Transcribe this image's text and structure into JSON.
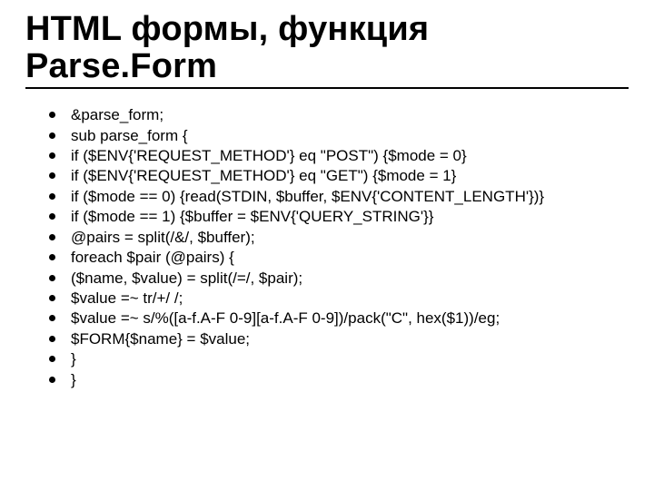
{
  "title_line1": "HTML формы, функция",
  "title_line2": "Parse.Form",
  "lines": [
    "&parse_form;",
    "sub parse_form {",
    "if ($ENV{'REQUEST_METHOD'} eq \"POST\") {$mode = 0}",
    "if ($ENV{'REQUEST_METHOD'} eq \"GET\") {$mode = 1}",
    "if ($mode == 0) {read(STDIN, $buffer, $ENV{'CONTENT_LENGTH'})}",
    "if ($mode == 1) {$buffer = $ENV{'QUERY_STRING'}}",
    "@pairs = split(/&/, $buffer);",
    "foreach $pair (@pairs) {",
    "($name, $value) = split(/=/, $pair);",
    "$value =~ tr/+/ /;",
    "$value =~ s/%([a-f.A-F 0-9][a-f.A-F 0-9])/pack(\"C\", hex($1))/eg;",
    "$FORM{$name} = $value;",
    "}",
    "}"
  ]
}
